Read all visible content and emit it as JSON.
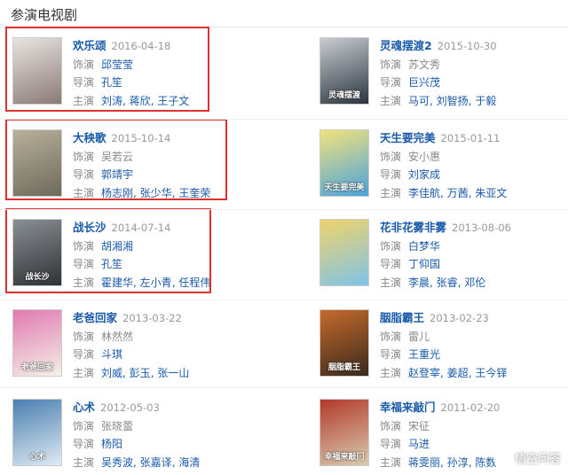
{
  "section": {
    "title": "参演电视剧"
  },
  "labels": {
    "role": "饰演",
    "director": "导演",
    "cast": "主演"
  },
  "shows": [
    {
      "title": "欢乐颂",
      "date": "2016-04-18",
      "role": "邱莹莹",
      "role_link": true,
      "director": [
        "孔笙"
      ],
      "cast": [
        "刘涛",
        "蒋欣",
        "王子文"
      ],
      "poster_colors": [
        "#8a7a78",
        "#e9e4e0"
      ],
      "poster_text": "",
      "highlighted": true
    },
    {
      "title": "灵魂摆渡2",
      "date": "2015-10-30",
      "role": "苏文秀",
      "role_link": false,
      "director": [
        "巨兴茂"
      ],
      "cast": [
        "马可",
        "刘智扬",
        "于毅"
      ],
      "poster_colors": [
        "#2b3640",
        "#c9cdd2"
      ],
      "poster_text": "灵魂摆渡",
      "highlighted": false
    },
    {
      "title": "大秧歌",
      "date": "2015-10-14",
      "role": "吴若云",
      "role_link": false,
      "director": [
        "郭靖宇"
      ],
      "cast": [
        "杨志刚",
        "张少华",
        "王奎荣"
      ],
      "poster_colors": [
        "#6e6a5c",
        "#b7b09a"
      ],
      "poster_text": "",
      "highlighted": true
    },
    {
      "title": "天生要完美",
      "date": "2015-01-11",
      "role": "安小惠",
      "role_link": false,
      "director": [
        "刘家成"
      ],
      "cast": [
        "李佳航",
        "万茜",
        "朱亚文"
      ],
      "poster_colors": [
        "#4aa3df",
        "#f3e27a"
      ],
      "poster_text": "天生要完美",
      "highlighted": false
    },
    {
      "title": "战长沙",
      "date": "2014-07-14",
      "role": "胡湘湘",
      "role_link": true,
      "director": [
        "孔笙"
      ],
      "cast": [
        "霍建华",
        "左小青",
        "任程伟"
      ],
      "poster_colors": [
        "#2e3237",
        "#8a8f94"
      ],
      "poster_text": "战长沙",
      "highlighted": true
    },
    {
      "title": "花非花雾非雾",
      "date": "2013-08-06",
      "role": "白梦华",
      "role_link": true,
      "director": [
        "丁仰国"
      ],
      "cast": [
        "李晨",
        "张睿",
        "邓伦"
      ],
      "poster_colors": [
        "#7fc3e8",
        "#f0d36a"
      ],
      "poster_text": "",
      "highlighted": false
    },
    {
      "title": "老爸回家",
      "date": "2013-03-22",
      "role": "林然然",
      "role_link": false,
      "director": [
        "斗琪"
      ],
      "cast": [
        "刘威",
        "彭玉",
        "张一山"
      ],
      "poster_colors": [
        "#f4f0e6",
        "#e07ab0"
      ],
      "poster_text": "老爸回家",
      "highlighted": false
    },
    {
      "title": "胭脂霸王",
      "date": "2013-02-23",
      "role": "雷儿",
      "role_link": false,
      "director": [
        "王重光"
      ],
      "cast": [
        "赵登宰",
        "姜超",
        "王今铎"
      ],
      "poster_colors": [
        "#3a2a1e",
        "#c56a2a"
      ],
      "poster_text": "胭脂霸王",
      "highlighted": false
    },
    {
      "title": "心术",
      "date": "2012-05-03",
      "role": "张晓蕾",
      "role_link": false,
      "director": [
        "杨阳"
      ],
      "cast": [
        "吴秀波",
        "张嘉译",
        "海清"
      ],
      "poster_colors": [
        "#dfeaf3",
        "#4a7fb0"
      ],
      "poster_text": "心术",
      "highlighted": false
    },
    {
      "title": "幸福来敲门",
      "date": "2011-02-20",
      "role": "宋征",
      "role_link": false,
      "director": [
        "马进"
      ],
      "cast": [
        "蒋雯丽",
        "孙淳",
        "陈数"
      ],
      "poster_colors": [
        "#d9cbb0",
        "#b23a2a"
      ],
      "poster_text": "幸福来敲门",
      "highlighted": false
    }
  ],
  "watermark": {
    "text": "悟空问答"
  },
  "colors": {
    "link": "#1a5aa8",
    "highlight_box": "#d9322f"
  }
}
